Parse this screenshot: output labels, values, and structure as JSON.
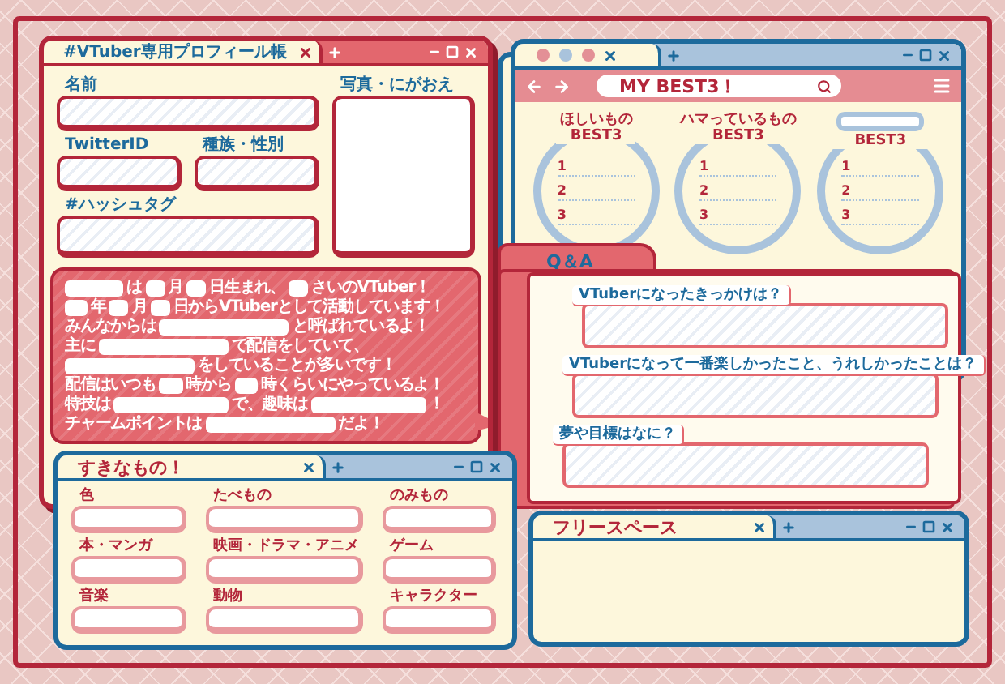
{
  "profile_window": {
    "title": "#VTuber専用プロフィール帳",
    "fields": [
      {
        "label": "名前"
      },
      {
        "label": "TwitterID"
      },
      {
        "label": "種族・性別"
      },
      {
        "label": "#ハッシュタグ"
      }
    ],
    "photo": {
      "label": "写真・にがおえ"
    },
    "bubble": [
      {
        "segments": [
          {
            "kind": "blank"
          },
          {
            "kind": "text",
            "text": "は"
          },
          {
            "kind": "blank"
          },
          {
            "kind": "text",
            "text": "月"
          },
          {
            "kind": "blank"
          },
          {
            "kind": "text",
            "text": "日生まれ、"
          },
          {
            "kind": "blank"
          },
          {
            "kind": "text",
            "text": "さいのVTuber！"
          }
        ]
      },
      {
        "segments": [
          {
            "kind": "blank"
          },
          {
            "kind": "text",
            "text": "年"
          },
          {
            "kind": "blank"
          },
          {
            "kind": "text",
            "text": "月"
          },
          {
            "kind": "blank"
          },
          {
            "kind": "text",
            "text": "日からVTuberとして活動しています！"
          }
        ]
      },
      {
        "segments": [
          {
            "kind": "text",
            "text": "みんなからは"
          },
          {
            "kind": "blank"
          },
          {
            "kind": "text",
            "text": "と呼ばれているよ！"
          }
        ]
      },
      {
        "segments": [
          {
            "kind": "text",
            "text": "主に"
          },
          {
            "kind": "blank"
          },
          {
            "kind": "text",
            "text": "で配信をしていて、"
          }
        ]
      },
      {
        "segments": [
          {
            "kind": "blank"
          },
          {
            "kind": "text",
            "text": "をしていることが多いです！"
          }
        ]
      },
      {
        "segments": [
          {
            "kind": "text",
            "text": "配信はいつも"
          },
          {
            "kind": "blank"
          },
          {
            "kind": "text",
            "text": "時から"
          },
          {
            "kind": "blank"
          },
          {
            "kind": "text",
            "text": "時くらいにやっているよ！"
          }
        ]
      },
      {
        "segments": [
          {
            "kind": "text",
            "text": "特技は"
          },
          {
            "kind": "blank"
          },
          {
            "kind": "text",
            "text": "で、趣味は"
          },
          {
            "kind": "blank"
          },
          {
            "kind": "text",
            "text": "！"
          }
        ]
      },
      {
        "segments": [
          {
            "kind": "text",
            "text": "チャームポイントは"
          },
          {
            "kind": "blank"
          },
          {
            "kind": "text",
            "text": "だよ！"
          }
        ]
      }
    ]
  },
  "favorites_window": {
    "title": "すきなもの！",
    "items": [
      {
        "label": "色"
      },
      {
        "label": "たべもの"
      },
      {
        "label": "のみもの"
      },
      {
        "label": "本・マンガ"
      },
      {
        "label": "映画・ドラマ・アニメ"
      },
      {
        "label": "ゲーム"
      },
      {
        "label": "音楽"
      },
      {
        "label": "動物"
      },
      {
        "label": "キャラクター"
      }
    ]
  },
  "best3_window": {
    "address": "MY BEST3！",
    "lists": [
      {
        "kind": "titled",
        "title": "ほしいもの",
        "subtitle": "BEST3",
        "numbers": [
          "1",
          "2",
          "3"
        ]
      },
      {
        "kind": "titled",
        "title": "ハマっているもの",
        "subtitle": "BEST3",
        "numbers": [
          "1",
          "2",
          "3"
        ]
      },
      {
        "kind": "blank_title",
        "subtitle": "BEST3",
        "numbers": [
          "1",
          "2",
          "3"
        ]
      }
    ]
  },
  "qa_folder": {
    "tab": "Q＆A",
    "questions": [
      {
        "text": "VTuberになったきっかけは？"
      },
      {
        "text": "VTuberになって一番楽しかったこと、うれしかったことは？"
      },
      {
        "text": "夢や目標はなに？"
      }
    ]
  },
  "free_window": {
    "title": "フリースペース"
  }
}
